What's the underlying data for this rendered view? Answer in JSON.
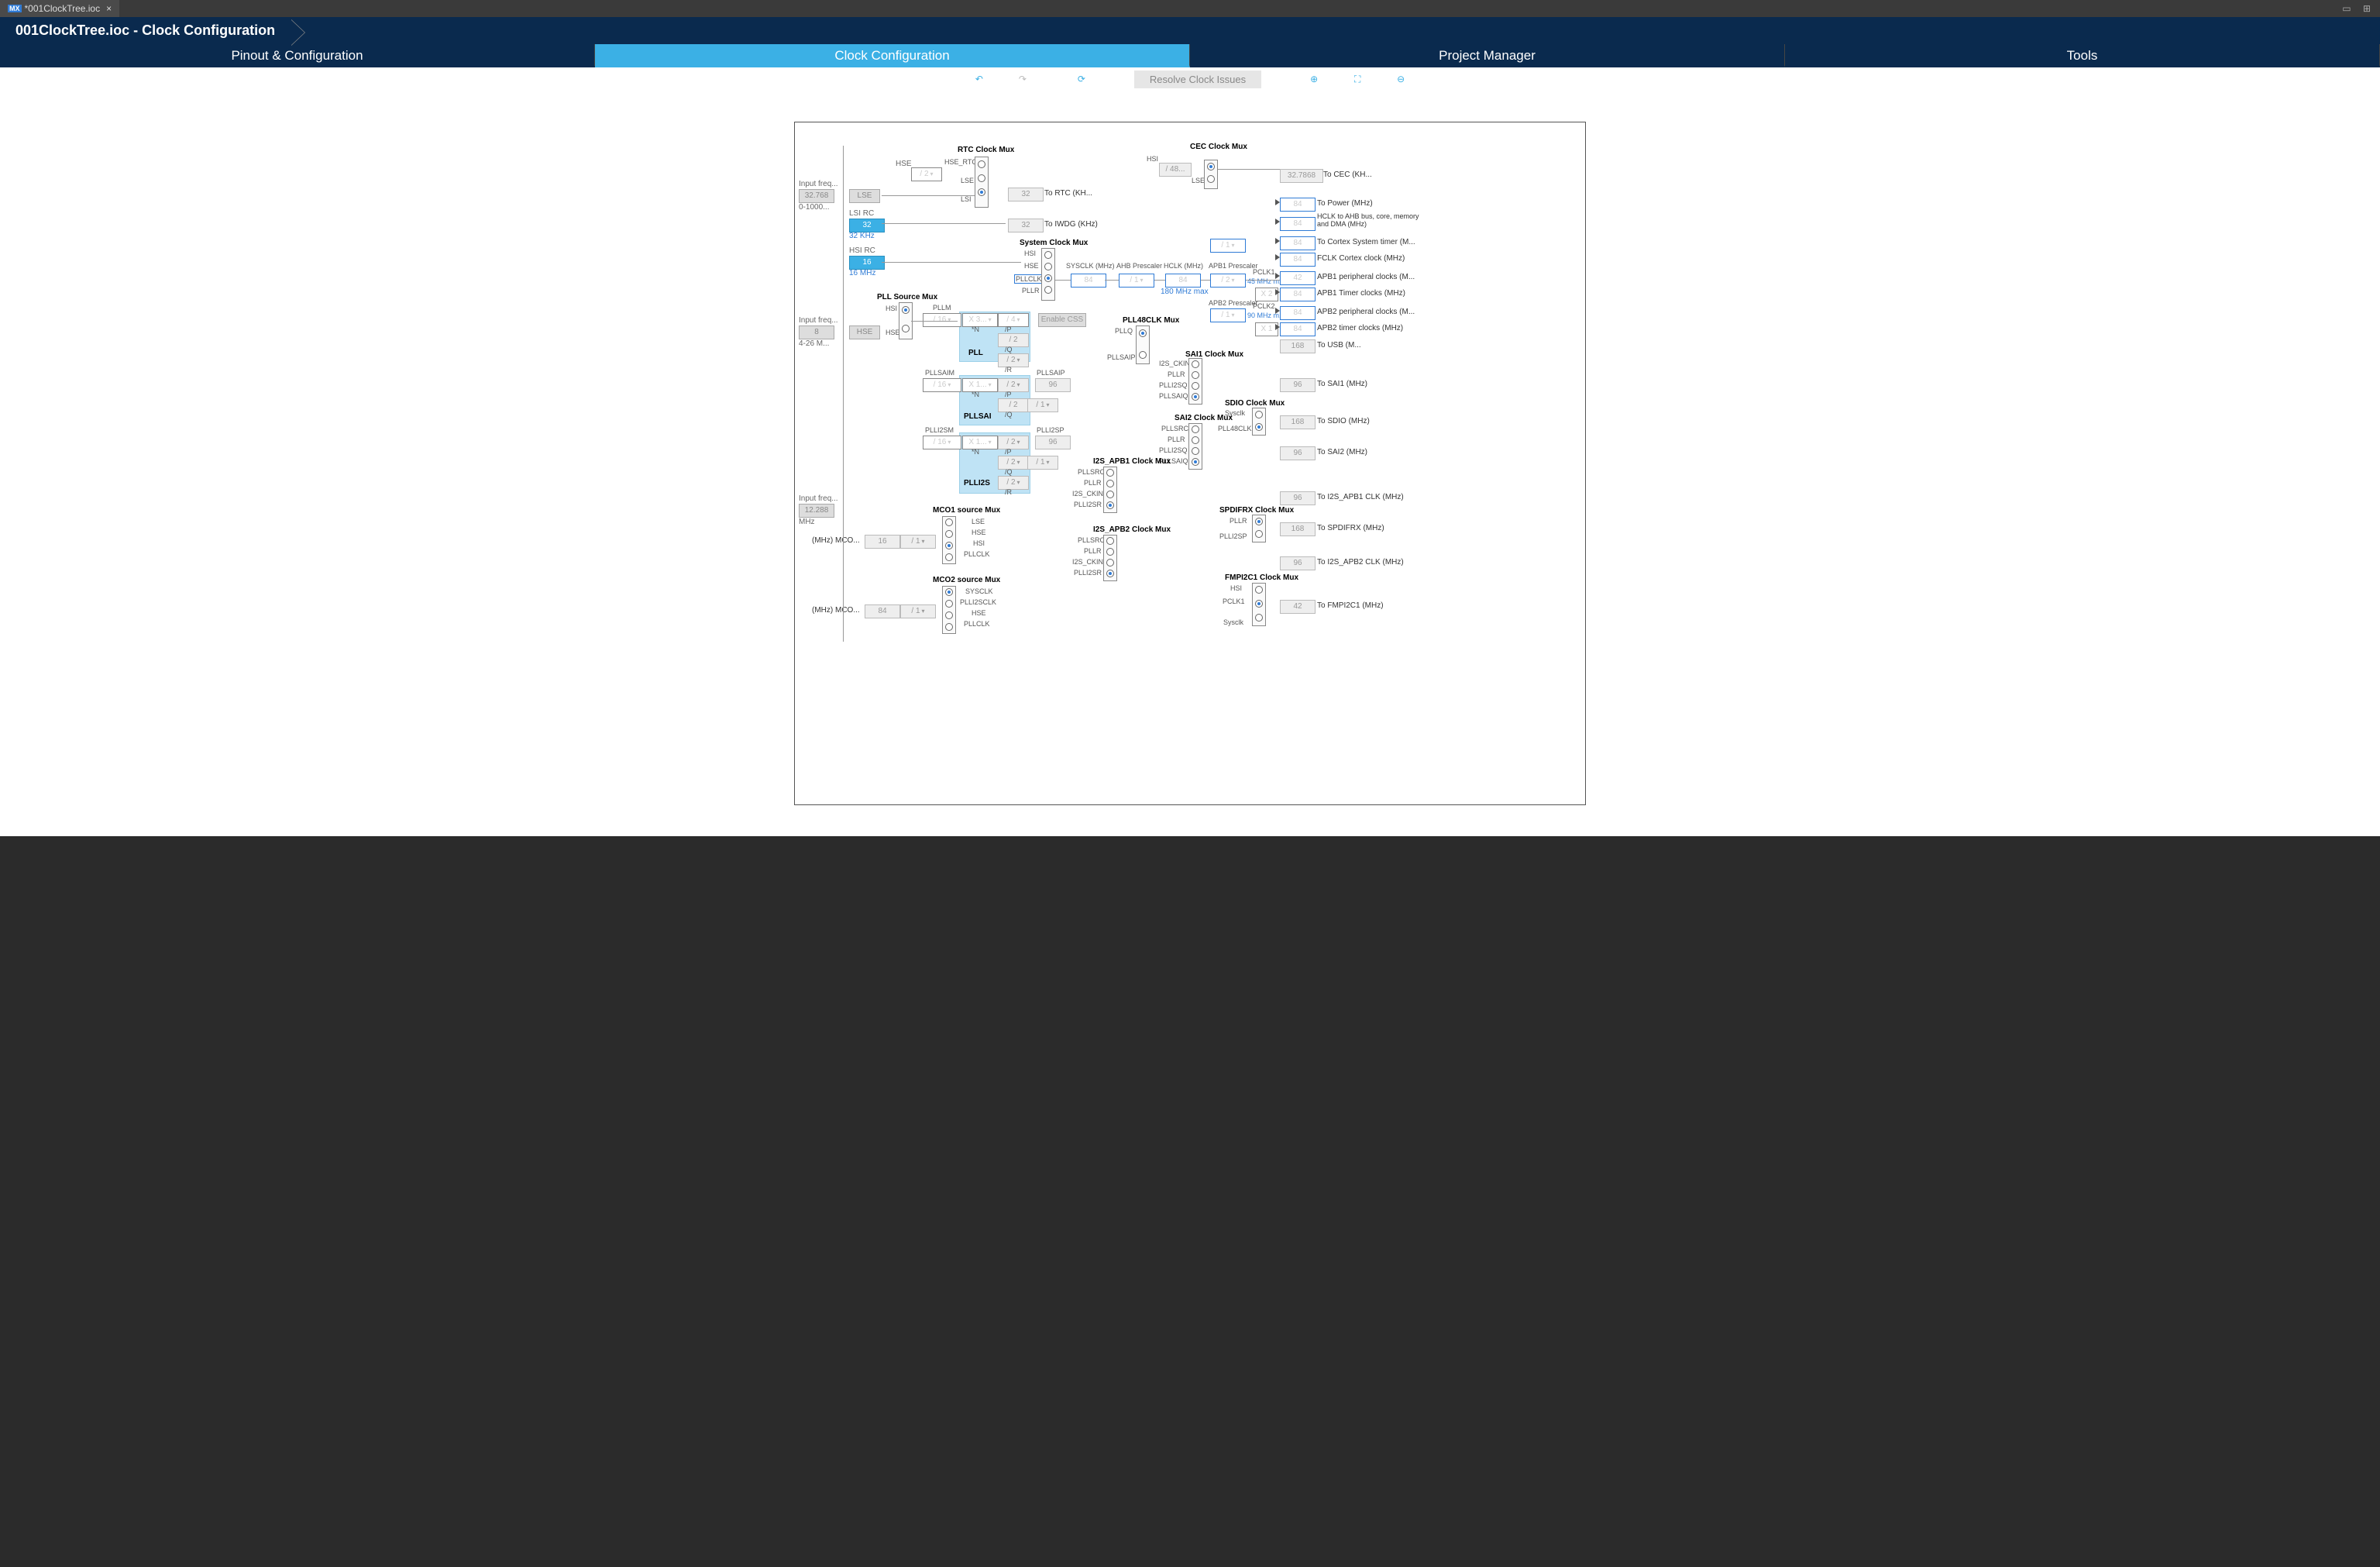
{
  "window": {
    "file_tab": "*001ClockTree.ioc",
    "breadcrumb": "001ClockTree.ioc - Clock Configuration"
  },
  "tabs": {
    "pinout": "Pinout & Configuration",
    "clock": "Clock Configuration",
    "project": "Project Manager",
    "tools": "Tools"
  },
  "toolbar": {
    "resolve": "Resolve Clock Issues"
  },
  "inputs": {
    "lse_freq_label": "Input freq...",
    "lse_freq": "32.768",
    "lse_range": "0-1000...",
    "hse_freq_label": "Input freq...",
    "hse_freq": "8",
    "hse_range": "4-26 M...",
    "i2s_freq_label": "Input freq...",
    "i2s_freq": "12.288",
    "i2s_unit": "MHz"
  },
  "sources": {
    "LSE": "LSE",
    "LSI_RC_label": "LSI RC",
    "LSI_RC": "32",
    "LSI_RC_sub": "32 KHz",
    "HSI_RC_label": "HSI RC",
    "HSI_RC": "16",
    "HSI_RC_sub": "16 MHz",
    "HSE": "HSE"
  },
  "rtc": {
    "title": "RTC Clock Mux",
    "hse_div": "/ 2",
    "hse_rtc": "HSE_RTC",
    "lse": "LSE",
    "lsi": "LSI",
    "out_val": "32",
    "out_label": "To RTC (KH..."
  },
  "iwdg": {
    "out_val": "32",
    "out_label": "To IWDG (KHz)"
  },
  "pll_src": {
    "title": "PLL Source Mux",
    "hsi": "HSI",
    "hse": "HSE"
  },
  "pll": {
    "M_label": "PLLM",
    "M": "/ 16",
    "N_label": "*N",
    "N": "X 3...",
    "P_label": "/P",
    "P": "/ 4",
    "Q_label": "/Q",
    "Q": "/ 2",
    "Q2": "/ 2",
    "R_label": "/R",
    "R": "/ 2",
    "name": "PLL"
  },
  "pllsai": {
    "M_label": "PLLSAIM",
    "M": "/ 16",
    "N_label": "*N",
    "N": "X 1...",
    "P_label": "/P",
    "P": "/ 2",
    "P_out_label": "PLLSAIP",
    "P_out": "96",
    "Q_label": "/Q",
    "Q": "/ 2",
    "Q_post": "/ 1",
    "name": "PLLSAI"
  },
  "plli2s": {
    "M_label": "PLLI2SM",
    "M": "/ 16",
    "N_label": "*N",
    "N": "X 1...",
    "P_label": "/P",
    "P": "/ 2",
    "P_out_label": "PLLI2SP",
    "P_out": "96",
    "Q_label": "/Q",
    "Q": "/ 2",
    "Q_post": "/ 1",
    "R_label": "/R",
    "R": "/ 2",
    "name": "PLLI2S"
  },
  "sysclk": {
    "title": "System Clock Mux",
    "hsi": "HSI",
    "hse": "HSE",
    "pllclk": "PLLCLK",
    "pllr": "PLLR",
    "enable_css": "Enable CSS",
    "sysclk_label": "SYSCLK (MHz)",
    "sysclk": "84",
    "ahb_label": "AHB Prescaler",
    "ahb": "/ 1",
    "hclk_label": "HCLK (MHz)",
    "hclk": "84",
    "hclk_max": "180 MHz max",
    "apb1_label": "APB1 Prescaler",
    "apb1": "/ 2",
    "pclk1_label": "PCLK1",
    "pclk1_note": "45 MHz m...",
    "x2": "X 2",
    "apb2_label": "APB2 Prescaler",
    "apb2": "/ 1",
    "pclk2_label": "PCLK2",
    "pclk2_note": "90 MHz m...",
    "x1": "X 1",
    "cortex_div": "/ 1"
  },
  "cec": {
    "title": "CEC Clock Mux",
    "hsi": "HSI",
    "hsi_div": "/ 48...",
    "lse": "LSE",
    "out": "32.7868",
    "out_label": "To CEC (KH..."
  },
  "right_outputs": {
    "power": {
      "v": "84",
      "l": "To Power (MHz)"
    },
    "ahb": {
      "v": "84",
      "l": "HCLK to AHB bus, core, memory and DMA (MHz)"
    },
    "cortex_timer": {
      "v": "84",
      "l": "To Cortex System timer (M..."
    },
    "fclk": {
      "v": "84",
      "l": "FCLK Cortex clock (MHz)"
    },
    "apb1_periph": {
      "v": "42",
      "l": "APB1 peripheral clocks (M..."
    },
    "apb1_timer": {
      "v": "84",
      "l": "APB1 Timer clocks (MHz)"
    },
    "apb2_periph": {
      "v": "84",
      "l": "APB2 peripheral clocks (M..."
    },
    "apb2_timer": {
      "v": "84",
      "l": "APB2 timer clocks (MHz)"
    },
    "usb": {
      "v": "168",
      "l": "To USB (M..."
    },
    "sai1": {
      "v": "96",
      "l": "To SAI1 (MHz)"
    },
    "sdio": {
      "v": "168",
      "l": "To SDIO (MHz)"
    },
    "sai2": {
      "v": "96",
      "l": "To SAI2 (MHz)"
    },
    "i2s_apb1": {
      "v": "96",
      "l": "To I2S_APB1 CLK (MHz)"
    },
    "spdifrx": {
      "v": "168",
      "l": "To SPDIFRX (MHz)"
    },
    "i2s_apb2": {
      "v": "96",
      "l": "To I2S_APB2 CLK (MHz)"
    },
    "fmpi2c1": {
      "v": "42",
      "l": "To FMPI2C1 (MHz)"
    }
  },
  "pll48": {
    "title": "PLL48CLK Mux",
    "pllq": "PLLQ",
    "pllsaip": "PLLSAIP"
  },
  "sai1_mux": {
    "title": "SAI1 Clock Mux",
    "i2s_ckin": "I2S_CKIN",
    "pllr": "PLLR",
    "plli2sq": "PLLI2SQ",
    "pllsaiq": "PLLSAIQ"
  },
  "sai2_mux": {
    "title": "SAI2 Clock Mux",
    "pllsrc": "PLLSRC",
    "pllr": "PLLR",
    "plli2sq": "PLLI2SQ",
    "pllsaiq": "PLLSAIQ"
  },
  "sdio_mux": {
    "title": "SDIO Clock Mux",
    "sysclk": "Sysclk",
    "pll48clk": "PLL48CLK"
  },
  "i2s_apb1_mux": {
    "title": "I2S_APB1 Clock Mux",
    "pllsrc": "PLLSRC",
    "pllr": "PLLR",
    "i2s_ckin": "I2S_CKIN",
    "plli2sr": "PLLI2SR"
  },
  "i2s_apb2_mux": {
    "title": "I2S_APB2 Clock Mux",
    "pllsrc": "PLLSRC",
    "pllr": "PLLR",
    "i2s_ckin": "I2S_CKIN",
    "plli2sr": "PLLI2SR"
  },
  "spdif_mux": {
    "title": "SPDIFRX Clock Mux",
    "pllr": "PLLR",
    "plli2sp": "PLLI2SP"
  },
  "fmpi2c_mux": {
    "title": "FMPI2C1 Clock Mux",
    "hsi": "HSI",
    "pclk1": "PCLK1",
    "sysclk": "Sysclk"
  },
  "mco1": {
    "title": "MCO1 source Mux",
    "lse": "LSE",
    "hse": "HSE",
    "hsi": "HSI",
    "pllclk": "PLLCLK",
    "div": "/ 1",
    "out": "16",
    "out_label": "(MHz) MCO..."
  },
  "mco2": {
    "title": "MCO2 source Mux",
    "sysclk": "SYSCLK",
    "plli2sclk": "PLLI2SCLK",
    "hse": "HSE",
    "pllclk": "PLLCLK",
    "div": "/ 1",
    "out": "84",
    "out_label": "(MHz) MCO..."
  }
}
